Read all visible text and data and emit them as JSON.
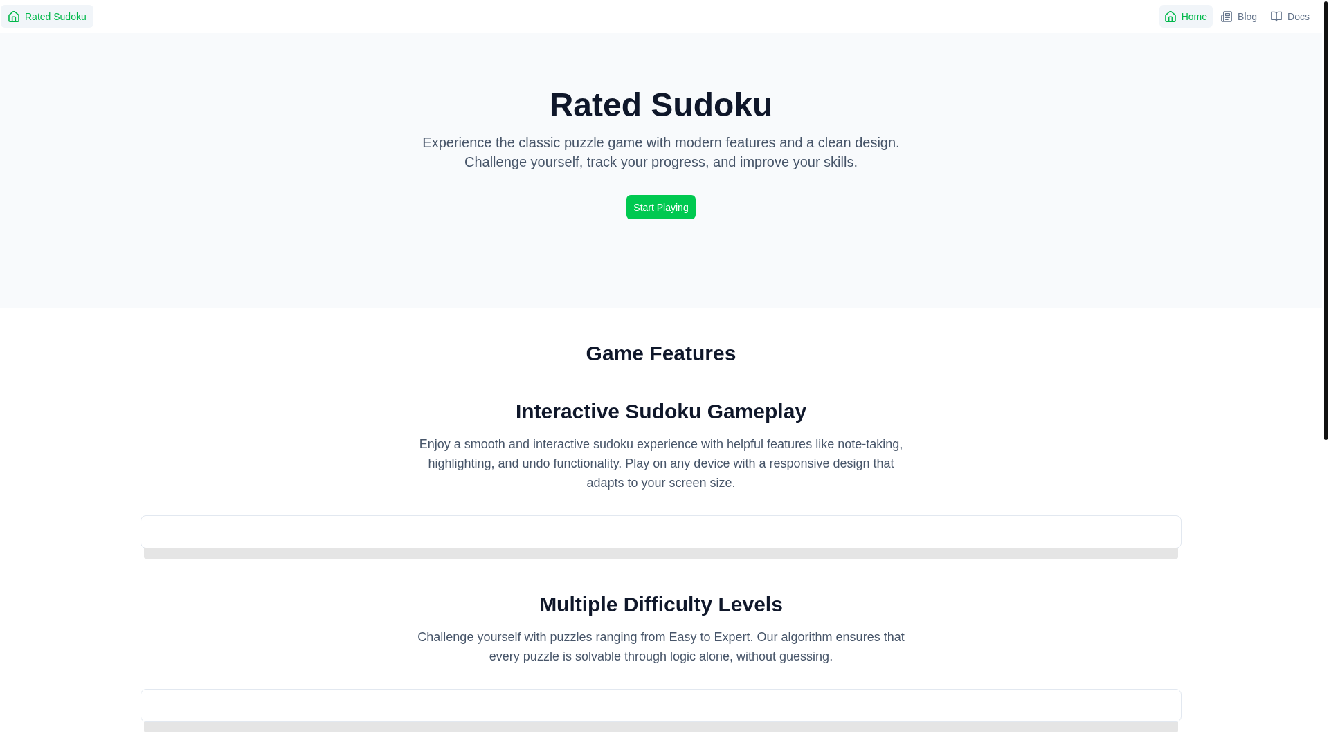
{
  "header": {
    "brand": {
      "label": "Rated Sudoku"
    },
    "nav": [
      {
        "label": "Home",
        "kind": "home",
        "selected": true
      },
      {
        "label": "Blog",
        "kind": "blog",
        "selected": false
      },
      {
        "label": "Docs",
        "kind": "docs",
        "selected": false
      }
    ]
  },
  "hero": {
    "title": "Rated Sudoku",
    "subtitle": "Experience the classic puzzle game with modern features and a clean design. Challenge yourself, track your progress, and improve your skills.",
    "cta": "Start Playing"
  },
  "features": {
    "heading": "Game Features",
    "items": [
      {
        "title": "Interactive Sudoku Gameplay",
        "description": "Enjoy a smooth and interactive sudoku experience with helpful features like note-taking, highlighting, and undo functionality. Play on any device with a responsive design that adapts to your screen size."
      },
      {
        "title": "Multiple Difficulty Levels",
        "description": "Challenge yourself with puzzles ranging from Easy to Expert. Our algorithm ensures that every puzzle is solvable through logic alone, without guessing."
      }
    ]
  }
}
